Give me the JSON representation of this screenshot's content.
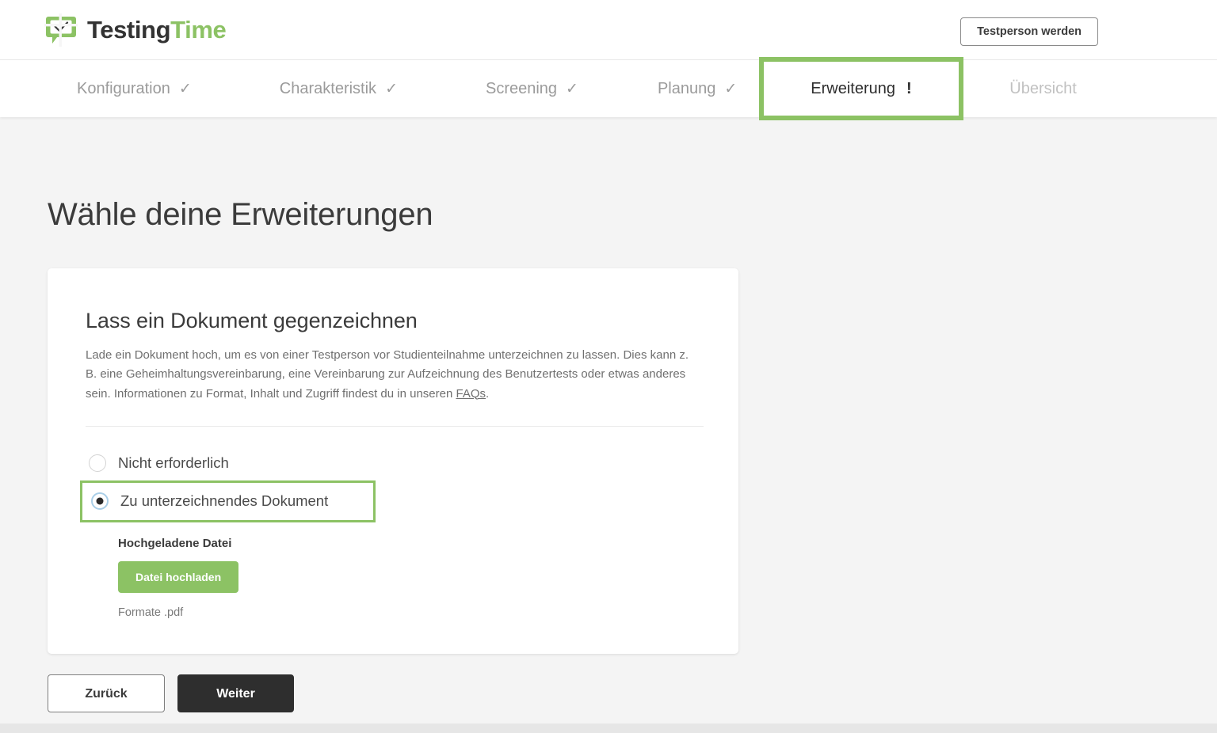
{
  "header": {
    "logo": {
      "icon": "speech-bubble-check-icon",
      "text_dark": "Testing",
      "text_green": "Time",
      "color_dark": "#333333",
      "color_green": "#8CC264"
    },
    "testperson_button": "Testperson werden"
  },
  "stepnav": {
    "steps": [
      {
        "label": "Konfiguration",
        "mark": "✓",
        "state": "done"
      },
      {
        "label": "Charakteristik",
        "mark": "✓",
        "state": "done"
      },
      {
        "label": "Screening",
        "mark": "✓",
        "state": "done"
      },
      {
        "label": "Planung",
        "mark": "✓",
        "state": "done"
      },
      {
        "label": "Erweiterung",
        "mark": "!",
        "state": "active"
      },
      {
        "label": "Übersicht",
        "mark": "",
        "state": "upcoming"
      }
    ],
    "active_index": 4,
    "highlight_color": "#8CC264"
  },
  "main": {
    "page_title": "Wähle deine Erweiterungen",
    "card": {
      "title": "Lass ein Dokument gegenzeichnen",
      "description_part1": "Lade ein Dokument hoch, um es von einer Testperson vor Studienteilnahme unterzeichnen zu lassen. Dies kann z. B. eine Geheimhaltungsvereinbarung, eine Vereinbarung zur Aufzeichnung des Benutzertests oder etwas anderes sein. Informationen zu Format, Inhalt und Zugriff findest du in unseren ",
      "description_link": "FAQs",
      "description_part2": ".",
      "options": [
        {
          "label": "Nicht erforderlich",
          "selected": false,
          "highlighted": false
        },
        {
          "label": "Zu unterzeichnendes Dokument",
          "selected": true,
          "highlighted": true
        }
      ],
      "upload": {
        "label": "Hochgeladene Datei",
        "button": "Datei hochladen",
        "hint": "Formate .pdf",
        "button_color": "#8CC264"
      }
    },
    "actions": {
      "back": "Zurück",
      "next": "Weiter"
    }
  }
}
